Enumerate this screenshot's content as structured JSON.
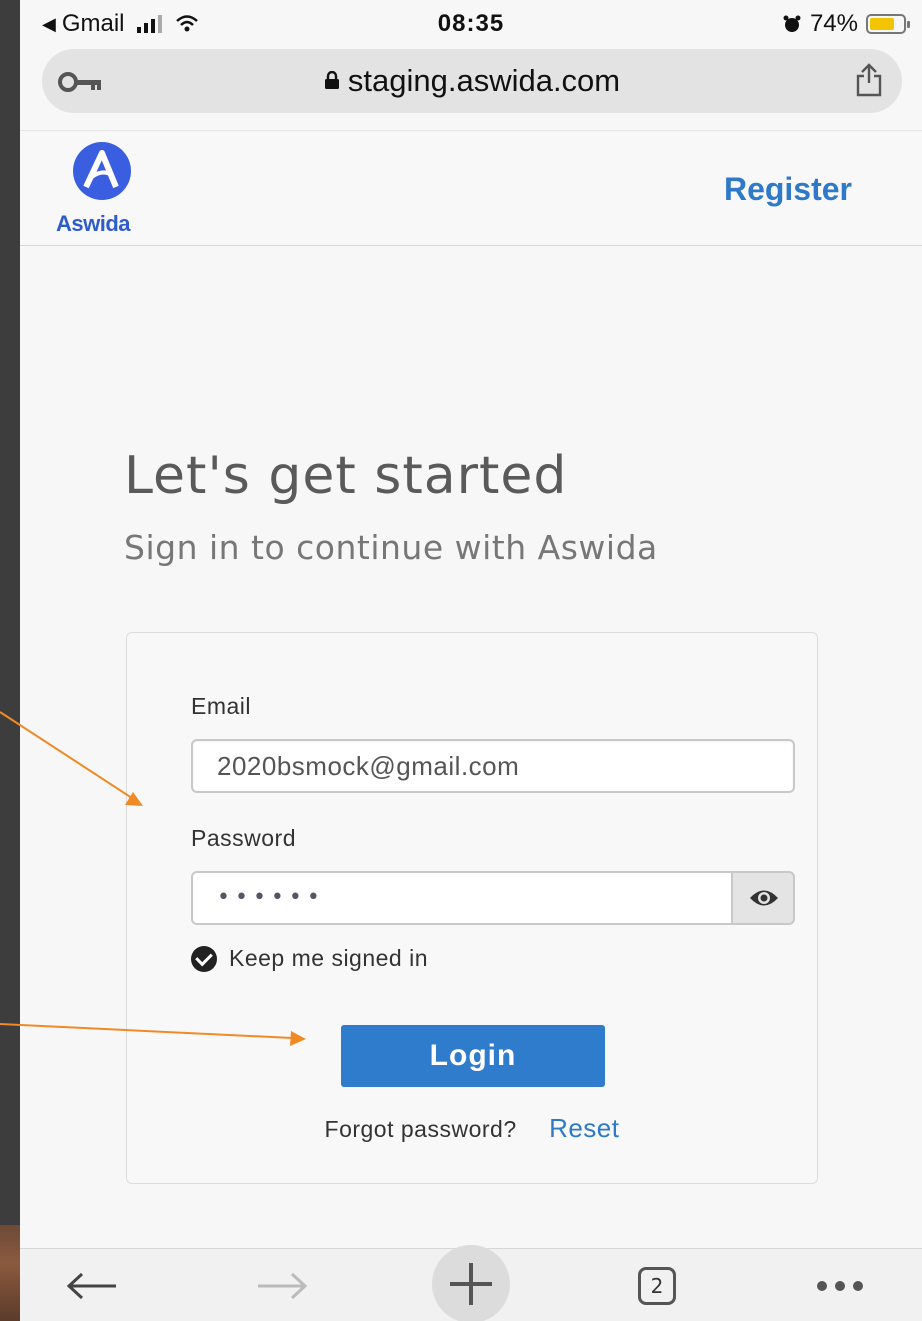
{
  "status_bar": {
    "back_app": "Gmail",
    "time": "08:35",
    "battery_percent": "74%",
    "battery_level": 0.74
  },
  "browser": {
    "url": "staging.aswida.com",
    "open_tabs": "2",
    "icons": [
      "key-icon",
      "lock-icon",
      "share-icon",
      "back-arrow-icon",
      "forward-arrow-icon",
      "new-tab-icon",
      "tabs-icon",
      "more-icon"
    ]
  },
  "header": {
    "logo_text": "Aswida",
    "register_label": "Register"
  },
  "main": {
    "heading": "Let's get started",
    "subheading": "Sign in to continue with Aswida"
  },
  "form": {
    "email_label": "Email",
    "email_value": "2020bsmock@gmail.com",
    "password_label": "Password",
    "password_mask": "••••••",
    "keep_signed_in_label": "Keep me signed in",
    "keep_signed_in_checked": true,
    "login_label": "Login",
    "forgot_text": "Forgot password?",
    "reset_label": "Reset"
  },
  "colors": {
    "brand_blue": "#2f7bcc",
    "logo_blue": "#3a5ee0",
    "annotation_orange": "#f08a24",
    "battery_yellow": "#f5c400"
  }
}
